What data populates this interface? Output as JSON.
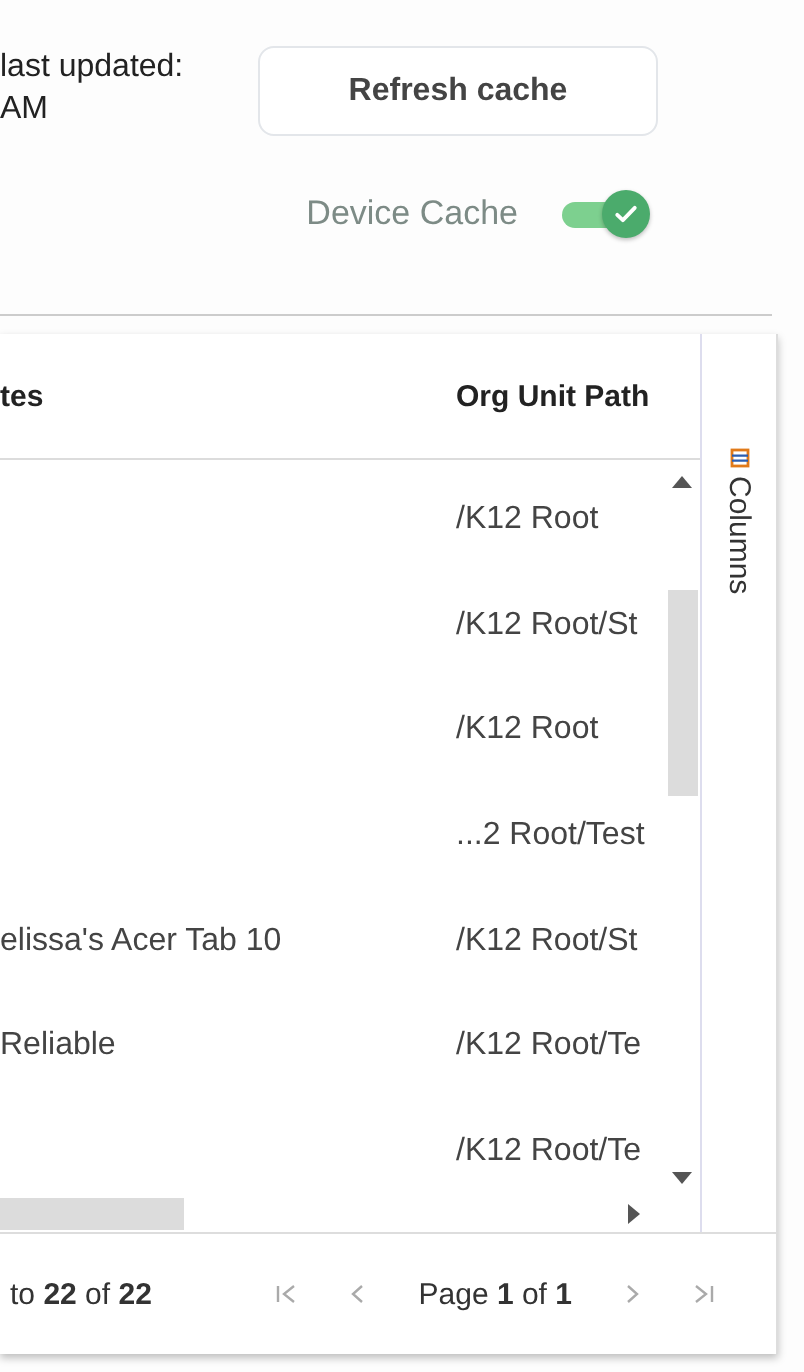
{
  "cache_status": {
    "lines": [
      "last updated:",
      "AM"
    ]
  },
  "refresh_button": {
    "label": "Refresh cache"
  },
  "device_cache": {
    "label": "Device Cache",
    "on": true
  },
  "table": {
    "columns": [
      "tes",
      "Org Unit Path"
    ],
    "rows": [
      {
        "org_unit_path": "/K12 Root"
      },
      {
        "org_unit_path": "/K12 Root/St"
      },
      {
        "org_unit_path": "/K12 Root"
      },
      {
        "org_unit_path": "...2 Root/Test"
      },
      {
        "column_1": "elissa's Acer Tab 10",
        "org_unit_path": "/K12 Root/St"
      },
      {
        "column_1": "Reliable",
        "org_unit_path": "/K12 Root/Te"
      },
      {
        "org_unit_path": "/K12 Root/Te"
      }
    ],
    "side_panel": {
      "label": "Columns"
    }
  },
  "footer": {
    "summary": "to **22** of **22**",
    "page": "Page **1** of **1**"
  }
}
